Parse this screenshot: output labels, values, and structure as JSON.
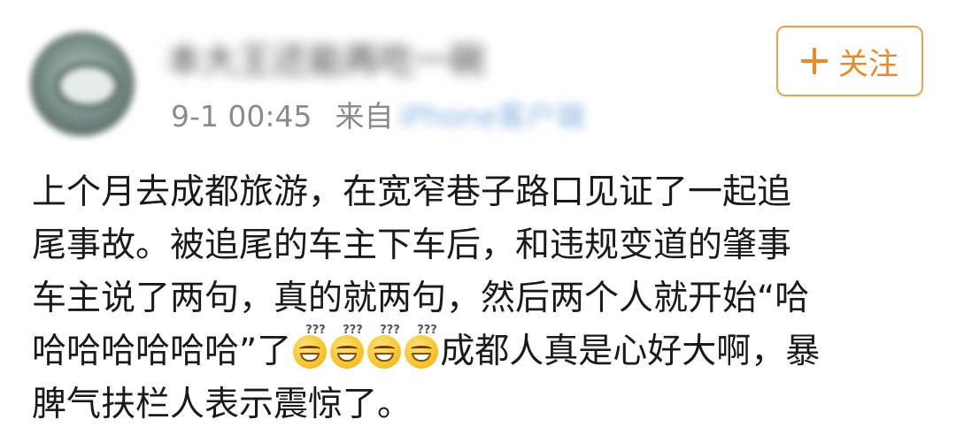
{
  "post": {
    "username": "本大王还能再吃一碗",
    "timestamp": "9-1 00:45",
    "source_prefix": "来自",
    "source_client": "iPhone客户端",
    "follow_label": "关注",
    "accent_color": "#e9892a",
    "emoji_name": "dizzy-laughing-face-emoji",
    "content_lines": [
      "上个月去成都旅游，在宽窄巷子路口见证了一起追",
      "尾事故。被追尾的车主下车后，和违规变道的肇事",
      "车主说了两句，真的就两句，然后两个人就开始“哈",
      "哈哈哈哈哈哈”了",
      "成都人真是心好大啊，暴",
      "脾气扶栏人表示震惊了。"
    ]
  }
}
